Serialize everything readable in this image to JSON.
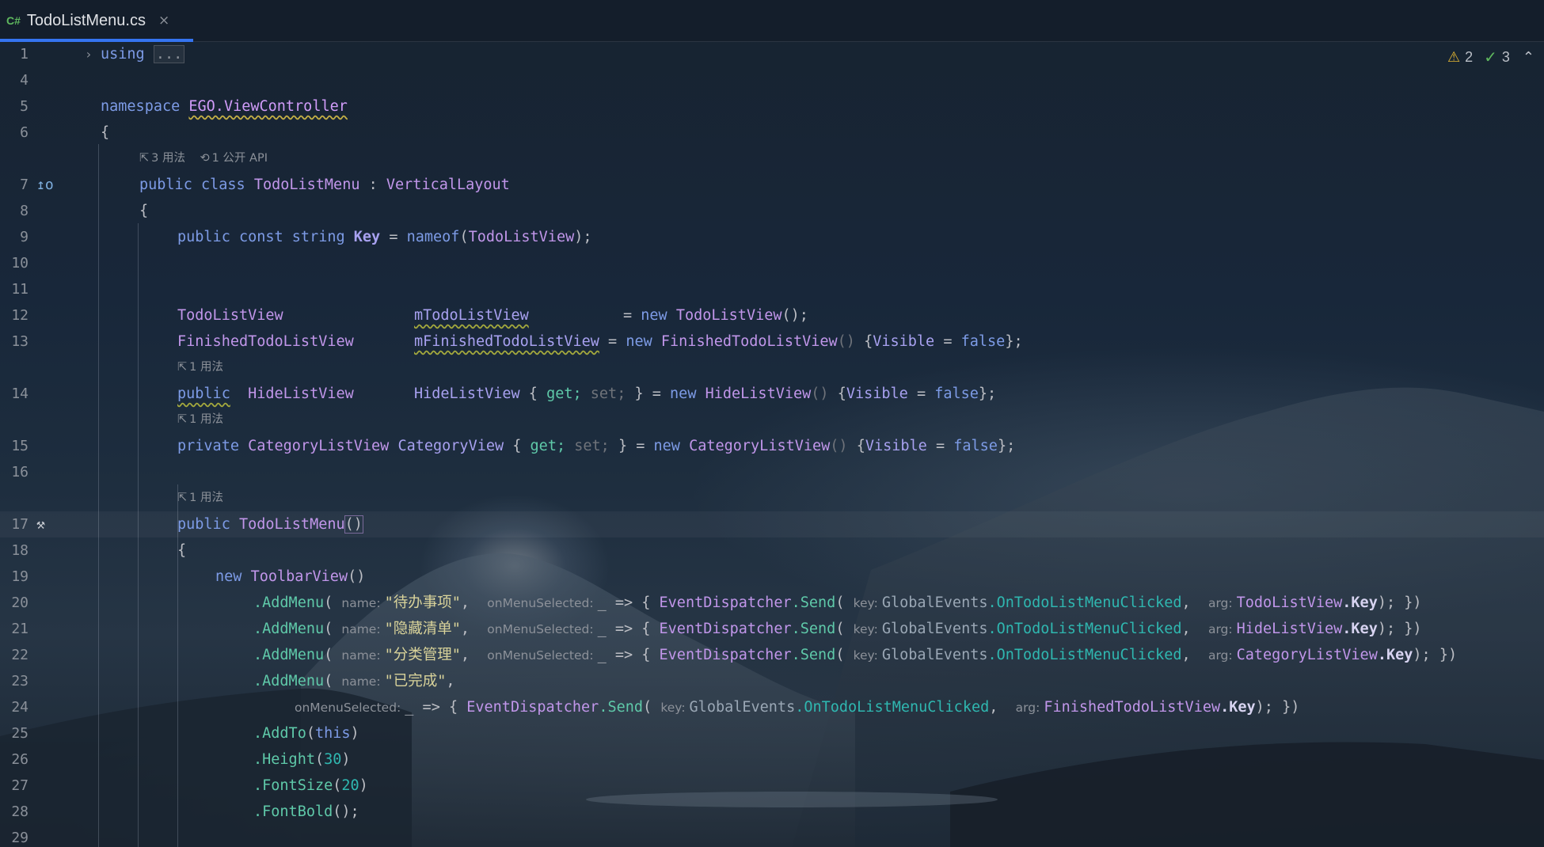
{
  "tab": {
    "lang": "C#",
    "title": "TodoListMenu.cs",
    "close": "×"
  },
  "inspections": {
    "warnings": "2",
    "ok": "3"
  },
  "hints": {
    "class_usages": "3 用法",
    "class_api": "1 公开 API",
    "usage1": "1 用法",
    "usage2": "1 用法",
    "usage3": "1 用法"
  },
  "line_numbers": [
    "1",
    "4",
    "5",
    "6",
    "7",
    "8",
    "9",
    "10",
    "11",
    "12",
    "13",
    "14",
    "15",
    "16",
    "17",
    "18",
    "19",
    "20",
    "21",
    "22",
    "23",
    "24",
    "25",
    "26",
    "27",
    "28",
    "29"
  ],
  "code": {
    "l1_using": "using",
    "l1_collapsed": "...",
    "l5_namespace": "namespace",
    "l5_name": "EGO.ViewController",
    "brace_open": "{",
    "l7_public": "public",
    "l7_class": "class",
    "l7_name": "TodoListMenu",
    "l7_colon": ":",
    "l7_base": "VerticalLayout",
    "l9_mods": "public const string",
    "l9_name": "Key",
    "l9_eq": "=",
    "l9_nameof": "nameof",
    "l9_arg": "TodoListView",
    "l9_end": ");",
    "l12_type": "TodoListView",
    "l12_field": "mTodoListView",
    "l12_eq": "=",
    "l12_new": "new",
    "l12_ctor": "TodoListView",
    "l12_end": "();",
    "l13_type": "FinishedTodoListView",
    "l13_field": "mFinishedTodoListView",
    "l13_eq": "=",
    "l13_new": "new",
    "l13_ctor": "FinishedTodoListView",
    "l13_parens": "()",
    "l13_init_open": "{",
    "l13_prop": "Visible",
    "l13_eq2": "=",
    "l13_false": "false",
    "l13_end": "};",
    "l14_public": "public",
    "l14_type": "HideListView",
    "l14_prop": "HideListView",
    "l14_acc_open": "{",
    "l14_get": "get;",
    "l14_set": "set;",
    "l14_acc_close": "}",
    "l14_eq": "=",
    "l14_new": "new",
    "l14_ctor": "HideListView",
    "l14_parens": "()",
    "l14_init_open": "{",
    "l14_vprop": "Visible",
    "l14_eq2": "=",
    "l14_false": "false",
    "l14_end": "};",
    "l15_private": "private",
    "l15_type": "CategoryListView",
    "l15_prop": "CategoryView",
    "l15_acc_open": "{",
    "l15_get": "get;",
    "l15_set": "set;",
    "l15_acc_close": "}",
    "l15_eq": "=",
    "l15_new": "new",
    "l15_ctor": "CategoryListView",
    "l15_parens": "()",
    "l15_init_open": "{",
    "l15_vprop": "Visible",
    "l15_eq2": "=",
    "l15_false": "false",
    "l15_end": "};",
    "l17_public": "public",
    "l17_ctor": "TodoListMenu",
    "l17_parens": "()",
    "l19_new": "new",
    "l19_type": "ToolbarView",
    "l19_parens": "()",
    "addmenu": ".AddMenu",
    "param_name": "name:",
    "param_onmenu": "onMenuSelected:",
    "param_key": "key:",
    "param_arg": "arg:",
    "lambda_start": "_ => {",
    "dispatcher": "EventDispatcher",
    "send": ".Send",
    "global_events": "GlobalEvents",
    "on_clicked": ".OnTodoListMenuClicked",
    "key_prop": ".Key",
    "l20_name": "\"待办事项\"",
    "l20_view": "TodoListView",
    "l21_name": "\"隐藏清单\"",
    "l21_view": "HideListView",
    "l22_name": "\"分类管理\"",
    "l22_view": "CategoryListView",
    "l23_name": "\"已完成\"",
    "l24_view": "FinishedTodoListView",
    "call_end": "); })",
    "l25": ".AddTo",
    "l25_this": "this",
    "l26": ".Height",
    "l26_num": "30",
    "l27": ".FontSize",
    "l27_num": "20",
    "l28": ".FontBold",
    "l28_end": "();"
  }
}
